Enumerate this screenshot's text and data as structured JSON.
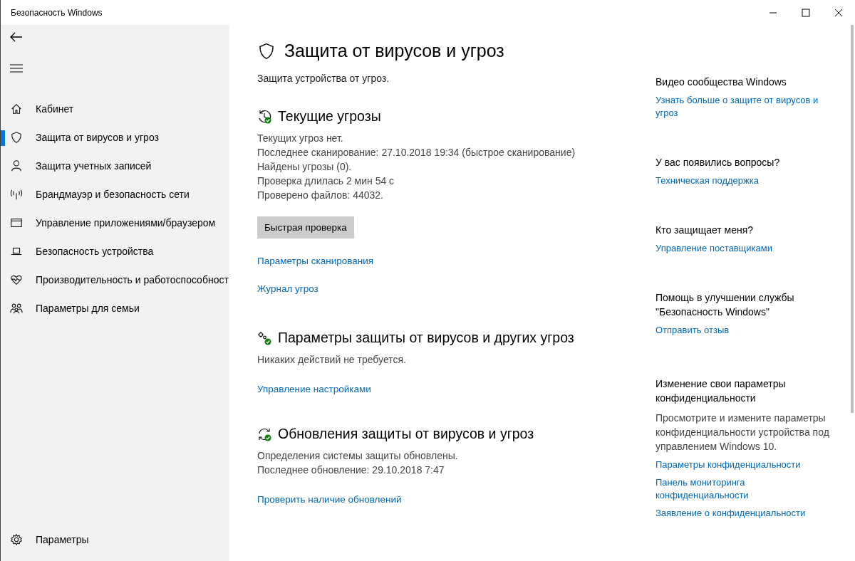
{
  "window": {
    "title": "Безопасность Windows"
  },
  "sidebar": {
    "items": [
      {
        "label": "Кабинет",
        "selected": false
      },
      {
        "label": "Защита от вирусов и угроз",
        "selected": true
      },
      {
        "label": "Защита учетных записей",
        "selected": false
      },
      {
        "label": "Брандмауэр и безопасность сети",
        "selected": false
      },
      {
        "label": "Управление приложениями/браузером",
        "selected": false
      },
      {
        "label": "Безопасность устройства",
        "selected": false
      },
      {
        "label": "Производительность и работоспособност",
        "selected": false
      },
      {
        "label": "Параметры для семьи",
        "selected": false
      }
    ],
    "settings": "Параметры"
  },
  "page": {
    "title": "Защита от вирусов и угроз",
    "subtitle": "Защита устройства от угроз."
  },
  "sections": [
    {
      "kind": "threats",
      "title": "Текущие угрозы",
      "lines": [
        "Текущих угроз нет.",
        "Последнее сканирование: 27.10.2018 19:34 (быстрое сканирование)",
        "Найдены угрозы (0).",
        "Проверка длилась 2 мин 54 с",
        "Проверено файлов: 44032."
      ],
      "button": "Быстрая проверка",
      "links": [
        "Параметры сканирования",
        "Журнал угроз"
      ]
    },
    {
      "kind": "settings",
      "title": "Параметры защиты от вирусов и других угроз",
      "lines": [
        "Никаких действий не требуется."
      ],
      "links": [
        "Управление настройками"
      ]
    },
    {
      "kind": "updates",
      "title": "Обновления защиты от вирусов и угроз",
      "lines": [
        "Определения системы защиты обновлены.",
        "Последнее обновление: 29.10.2018 7:47"
      ],
      "links": [
        "Проверить наличие обновлений"
      ]
    }
  ],
  "aside": [
    {
      "heading": "Видео сообщества Windows",
      "links": [
        "Узнать больше о защите от вирусов и угроз"
      ]
    },
    {
      "heading": "У вас появились вопросы?",
      "links": [
        "Техническая поддержка"
      ]
    },
    {
      "heading": "Кто защищает меня?",
      "links": [
        "Управление поставщиками"
      ]
    },
    {
      "heading": "Помощь в улучшении службы \"Безопасность Windows\"",
      "links": [
        "Отправить отзыв"
      ]
    },
    {
      "heading": "Изменение свои параметры конфиденциальности",
      "text": "Просмотрите и измените параметры конфиденциальности устройства под управлением Windows 10.",
      "links": [
        "Параметры конфиденциальности",
        "Панель мониторинга конфиденциальности",
        "Заявление о конфиденциальности"
      ]
    }
  ]
}
